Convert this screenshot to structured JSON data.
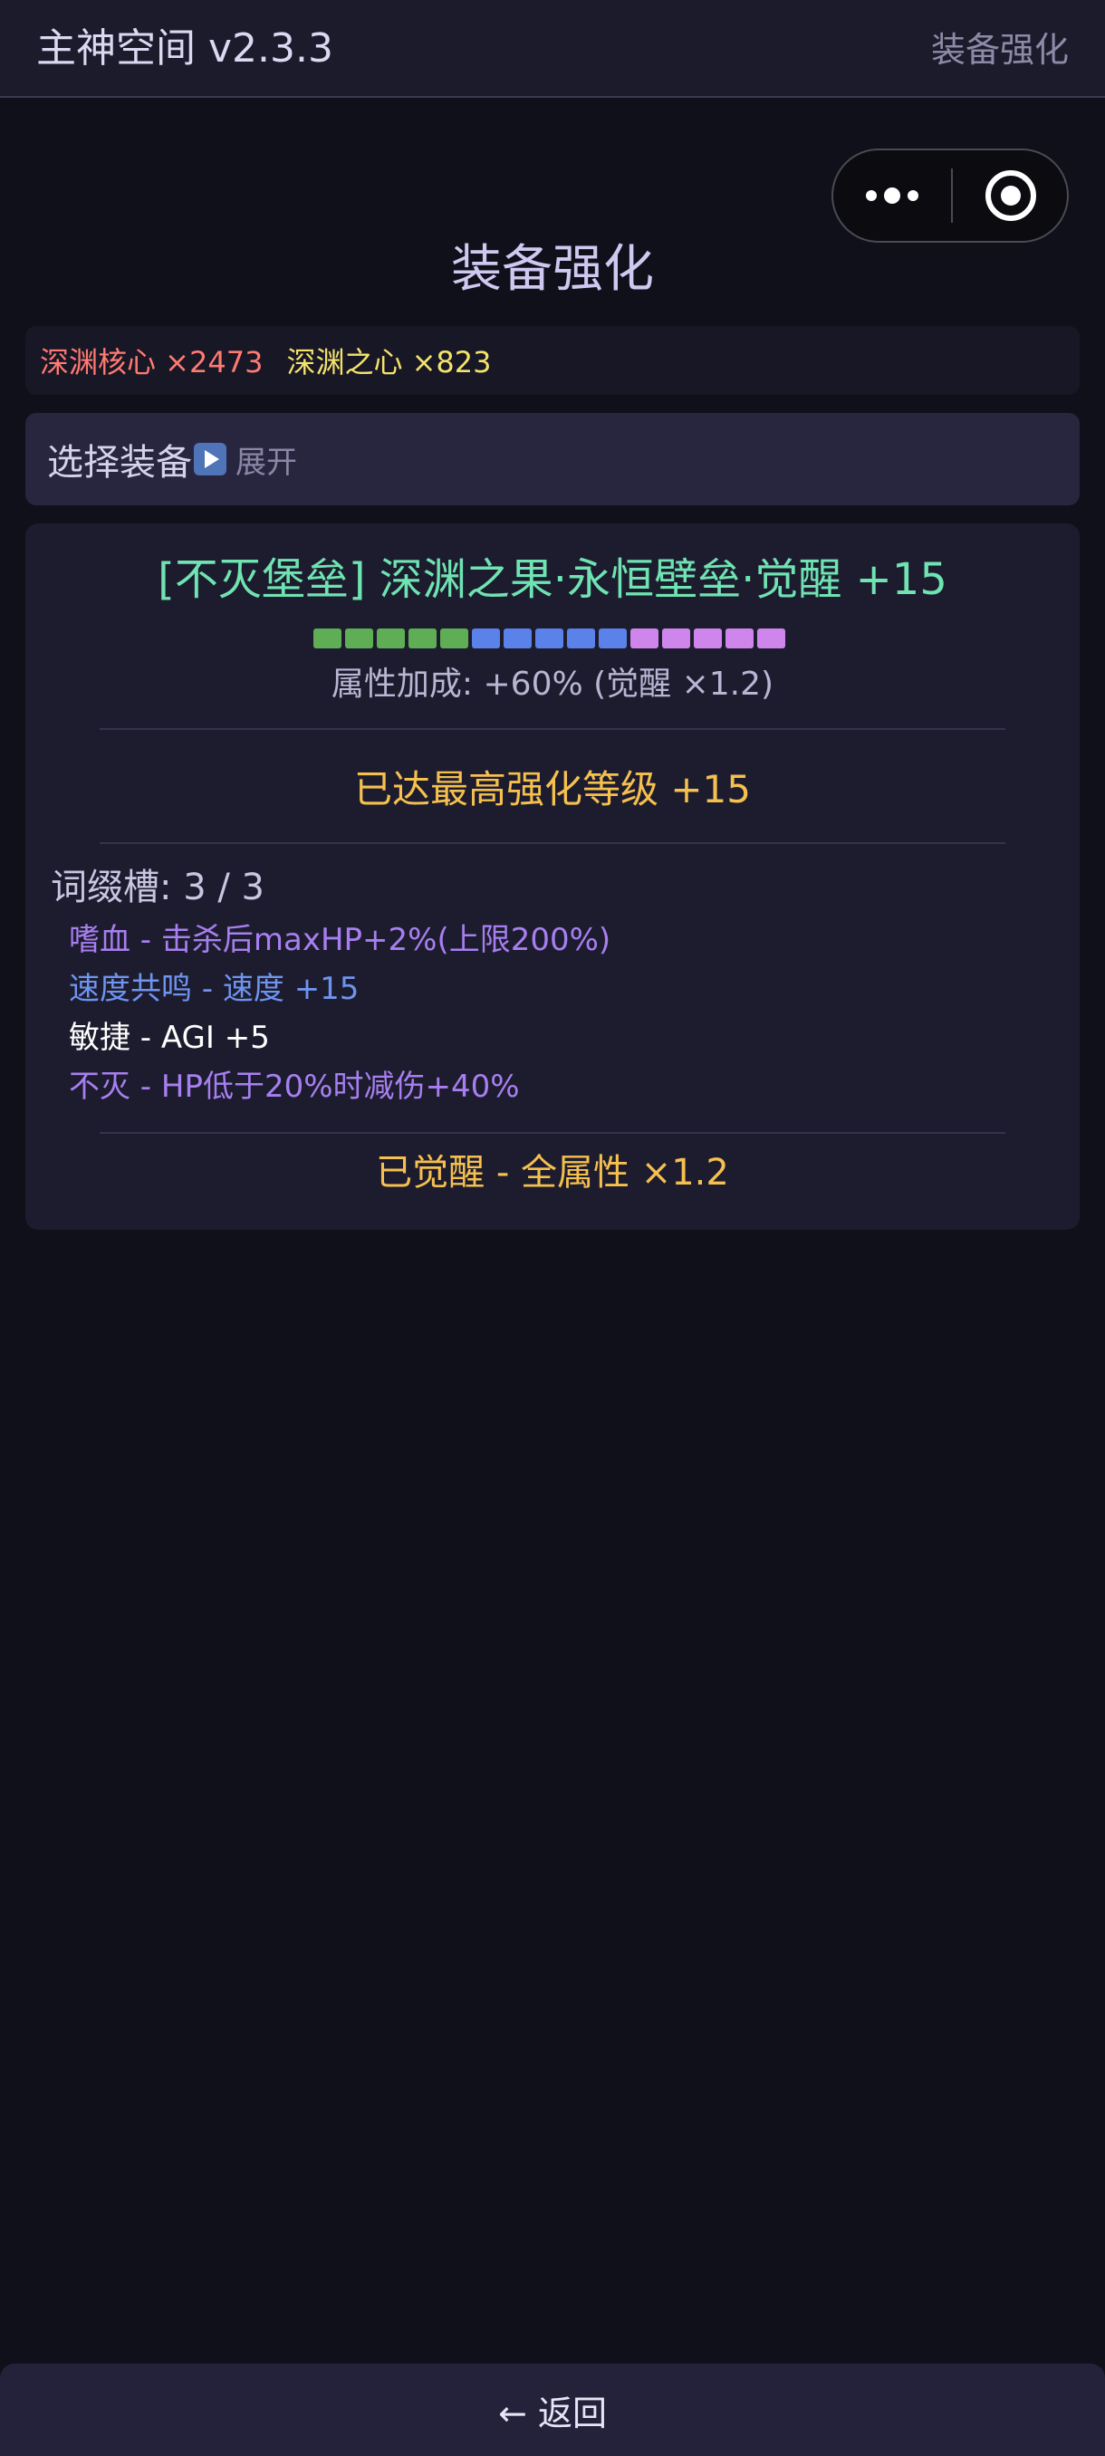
{
  "header": {
    "app_title": "主神空间 v2.3.3",
    "page_name": "装备强化"
  },
  "capsule": {
    "more_icon": "more-dots-icon",
    "close_icon": "target-circle-icon"
  },
  "page": {
    "title": "装备强化"
  },
  "resources": {
    "abyss_core": "深渊核心 ×2473",
    "abyss_heart": "深渊之心 ×823"
  },
  "selector": {
    "label": "选择装备",
    "expand_icon": "play-icon",
    "expand_label": "展开"
  },
  "item": {
    "name": "[不灭堡垒] 深渊之果·永恒壁垒·觉醒 +15",
    "enhance_level": 15,
    "level_segments": [
      {
        "color": "#5fae55"
      },
      {
        "color": "#5fae55"
      },
      {
        "color": "#5fae55"
      },
      {
        "color": "#5fae55"
      },
      {
        "color": "#5fae55"
      },
      {
        "color": "#5b82e8"
      },
      {
        "color": "#5b82e8"
      },
      {
        "color": "#5b82e8"
      },
      {
        "color": "#5b82e8"
      },
      {
        "color": "#5b82e8"
      },
      {
        "color": "#cf86ec"
      },
      {
        "color": "#cf86ec"
      },
      {
        "color": "#cf86ec"
      },
      {
        "color": "#cf86ec"
      },
      {
        "color": "#cf86ec"
      }
    ],
    "bonus": "属性加成: +60% (觉醒 ×1.2)",
    "max_level_notice": "已达最高强化等级 +15",
    "affix_header": "词缀槽: 3 / 3",
    "affixes": [
      {
        "text": "嗜血 - 击杀后maxHP+2%(上限200%)",
        "color": "#a77ff0"
      },
      {
        "text": "速度共鸣 - 速度 +15",
        "color": "#6e94f0"
      },
      {
        "text": "敏捷 - AGI +5",
        "color": "#ffffff"
      },
      {
        "text": "不灭 - HP低于20%时减伤+40%",
        "color": "#a77ff0"
      }
    ],
    "awaken": "已觉醒 - 全属性 ×1.2"
  },
  "footer": {
    "back_label": "← 返回"
  },
  "colors": {
    "background": "#10101a",
    "item_name": "#6fe3b2",
    "gold": "#f6c04f",
    "core": "#ff7a72",
    "heart": "#f3e36d"
  }
}
